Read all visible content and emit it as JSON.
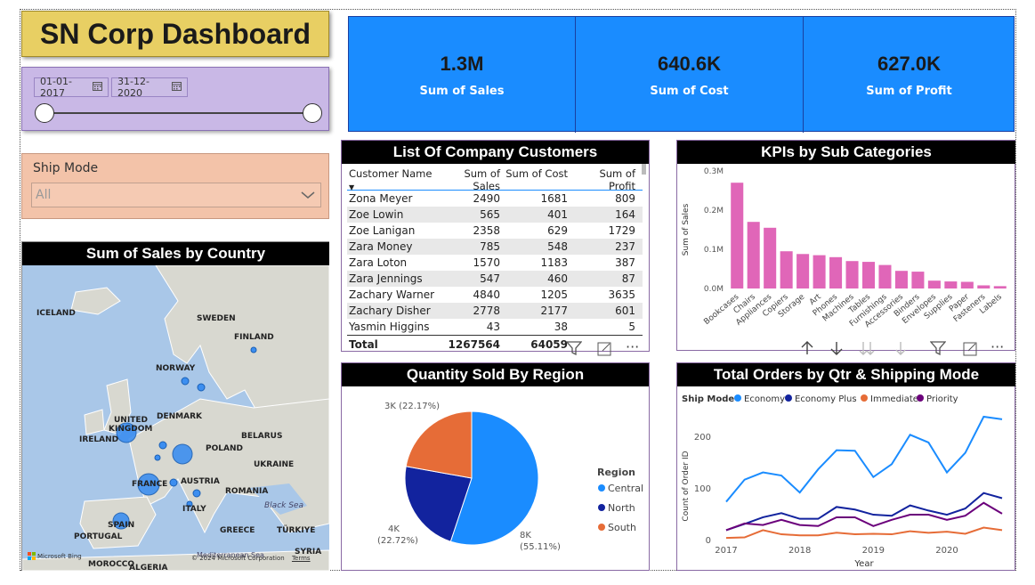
{
  "dashboard": {
    "title": "SN Corp Dashboard"
  },
  "date_filter": {
    "start": "01-01-2017",
    "end": "31-12-2020"
  },
  "ship_mode": {
    "label": "Ship Mode",
    "value": "All"
  },
  "kpis": [
    {
      "value": "1.3M",
      "label": "Sum of Sales"
    },
    {
      "value": "640.6K",
      "label": "Sum of Cost"
    },
    {
      "value": "627.0K",
      "label": "Sum of Profit"
    }
  ],
  "map": {
    "title": "Sum of Sales by Country",
    "labels": [
      "ICELAND",
      "SWEDEN",
      "FINLAND",
      "NORWAY",
      "UNITED",
      "KINGDOM",
      "DENMARK",
      "IRELAND",
      "BELARUS",
      "POLAND",
      "UKRAINE",
      "FRANCE",
      "AUSTRIA",
      "ROMANIA",
      "ITALY",
      "Black Sea",
      "SPAIN",
      "PORTUGAL",
      "GREECE",
      "TÜRKIYE",
      "Mediterranean Sea",
      "SYRIA",
      "MOROCCO",
      "ALGERIA"
    ],
    "attribution": "© 2024 Microsoft Corporation",
    "terms": "Terms",
    "bing": "Microsoft Bing"
  },
  "customers_table": {
    "title": "List Of Company Customers",
    "columns": [
      "Customer Name",
      "Sum of Sales",
      "Sum of Cost",
      "Sum of Profit"
    ],
    "rows": [
      [
        "Zona Meyer",
        "2490",
        "1681",
        "809"
      ],
      [
        "Zoe Lowin",
        "565",
        "401",
        "164"
      ],
      [
        "Zoe Lanigan",
        "2358",
        "629",
        "1729"
      ],
      [
        "Zara Money",
        "785",
        "548",
        "237"
      ],
      [
        "Zara Loton",
        "1570",
        "1183",
        "387"
      ],
      [
        "Zara Jennings",
        "547",
        "460",
        "87"
      ],
      [
        "Zachary Warner",
        "4840",
        "1205",
        "3635"
      ],
      [
        "Zachary Disher",
        "2778",
        "2177",
        "601"
      ],
      [
        "Yasmin Higgins",
        "43",
        "38",
        "5"
      ]
    ],
    "total": [
      "Total",
      "1267564",
      "64059",
      ""
    ]
  },
  "chart_data": [
    {
      "type": "bar",
      "title": "KPIs by Sub Categories",
      "ylabel": "Sum of Sales",
      "categories": [
        "Bookcases",
        "Chairs",
        "Appliances",
        "Copiers",
        "Storage",
        "Art",
        "Phones",
        "Machines",
        "Tables",
        "Furnishings",
        "Accessories",
        "Binders",
        "Envelopes",
        "Supplies",
        "Paper",
        "Fasteners",
        "Labels"
      ],
      "values": [
        0.27,
        0.17,
        0.155,
        0.095,
        0.088,
        0.085,
        0.08,
        0.07,
        0.068,
        0.06,
        0.045,
        0.043,
        0.02,
        0.018,
        0.017,
        0.008,
        0.006
      ],
      "yticks": [
        "0.0M",
        "0.1M",
        "0.2M",
        "0.3M"
      ],
      "ylim": [
        0,
        0.3
      ],
      "color": "#e066b8"
    },
    {
      "type": "pie",
      "title": "Quantity Sold By Region",
      "legend_title": "Region",
      "slices": [
        {
          "name": "Central",
          "value": 55.11,
          "label": "8K",
          "pct": "(55.11%)",
          "color": "#1a8cff"
        },
        {
          "name": "North",
          "value": 22.72,
          "label": "4K",
          "pct": "(22.72%)",
          "color": "#12239e"
        },
        {
          "name": "South",
          "value": 22.17,
          "label": "3K (22.17%)",
          "pct": "",
          "color": "#e66c37"
        }
      ]
    },
    {
      "type": "line",
      "title": "Total Orders by Qtr & Shipping Mode",
      "legend_title": "Ship Mode",
      "xlabel": "Year",
      "ylabel": "Count of Order ID",
      "xticks": [
        "2017",
        "2018",
        "2019",
        "2020"
      ],
      "yticks": [
        "0",
        "100",
        "200"
      ],
      "ylim": [
        0,
        240
      ],
      "series": [
        {
          "name": "Economy",
          "color": "#1a8cff",
          "values": [
            75,
            118,
            132,
            126,
            93,
            138,
            175,
            174,
            123,
            148,
            205,
            190,
            132,
            170,
            240,
            235
          ]
        },
        {
          "name": "Economy Plus",
          "color": "#12239e",
          "values": [
            20,
            32,
            45,
            53,
            42,
            42,
            65,
            60,
            50,
            48,
            68,
            58,
            50,
            62,
            92,
            82
          ]
        },
        {
          "name": "Immediate",
          "color": "#e66c37",
          "values": [
            5,
            6,
            20,
            12,
            10,
            10,
            15,
            12,
            13,
            12,
            18,
            15,
            17,
            13,
            25,
            20
          ]
        },
        {
          "name": "Priority",
          "color": "#6b007b",
          "values": [
            20,
            33,
            30,
            40,
            30,
            28,
            45,
            45,
            28,
            40,
            50,
            50,
            40,
            48,
            73,
            52
          ]
        }
      ]
    }
  ]
}
